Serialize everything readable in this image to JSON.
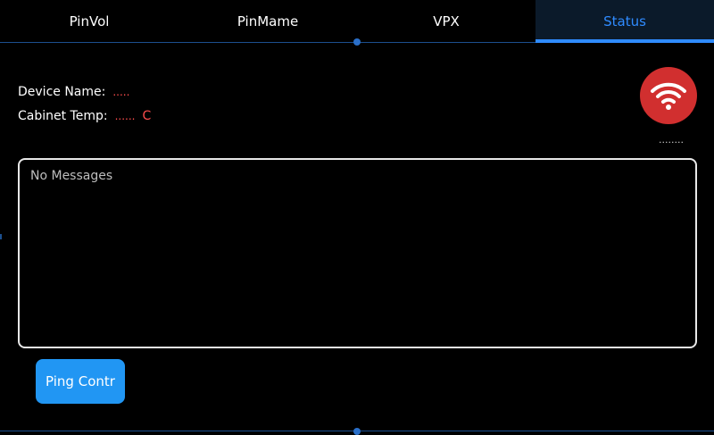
{
  "tabs": [
    {
      "label": "PinVol",
      "active": false
    },
    {
      "label": "PinMame",
      "active": false
    },
    {
      "label": "VPX",
      "active": false
    },
    {
      "label": "Status",
      "active": true
    }
  ],
  "status": {
    "device_name_label": "Device Name:",
    "device_name_value": ".....",
    "cabinet_temp_label": "Cabinet Temp:",
    "cabinet_temp_value": "......",
    "cabinet_temp_unit": "C",
    "wifi_icon": "wifi-icon",
    "wifi_status_text": "........",
    "messages_text": "No Messages",
    "ping_button_label": "Ping Contr"
  },
  "colors": {
    "accent": "#2f8bff",
    "wifi_button": "#d12f2f",
    "value_text": "#ff4d4d",
    "button": "#2196f3"
  }
}
